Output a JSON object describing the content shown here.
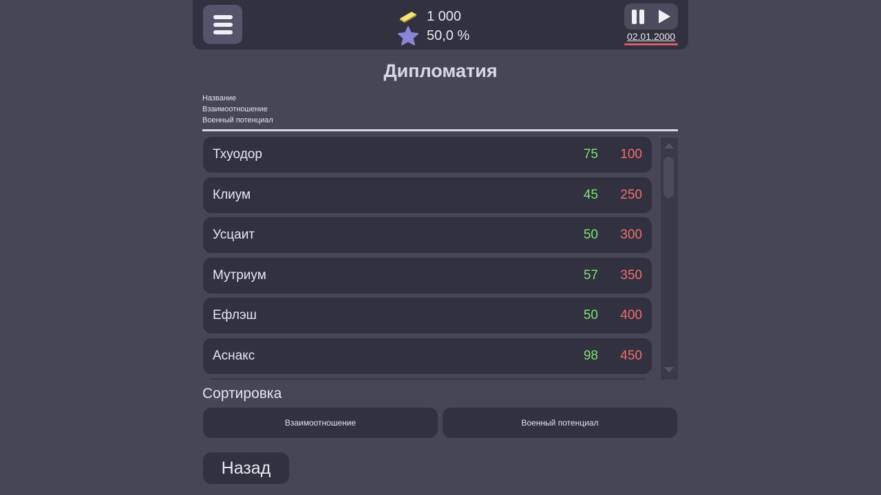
{
  "header": {
    "gold": "1 000",
    "rating": "50,0 %",
    "date": "02.01.2000"
  },
  "title": "Дипломатия",
  "legend": [
    "Название",
    "Взаимоотношение",
    "Военный потенциал"
  ],
  "countries": [
    {
      "name": "Тхуодор",
      "relation": "75",
      "military": "100"
    },
    {
      "name": "Клиум",
      "relation": "45",
      "military": "250"
    },
    {
      "name": "Усцаит",
      "relation": "50",
      "military": "300"
    },
    {
      "name": "Мутриум",
      "relation": "57",
      "military": "350"
    },
    {
      "name": "Ефлэш",
      "relation": "50",
      "military": "400"
    },
    {
      "name": "Аснакс",
      "relation": "98",
      "military": "450"
    }
  ],
  "sort": {
    "label": "Сортировка",
    "by_relation": "Взаимоотношение",
    "by_military": "Военный потенциал"
  },
  "back_label": "Назад",
  "colors": {
    "background": "#474656",
    "panel": "#32313f",
    "relation": "#7fe07a",
    "military": "#f06f6f",
    "date_underline": "#e05c66"
  }
}
